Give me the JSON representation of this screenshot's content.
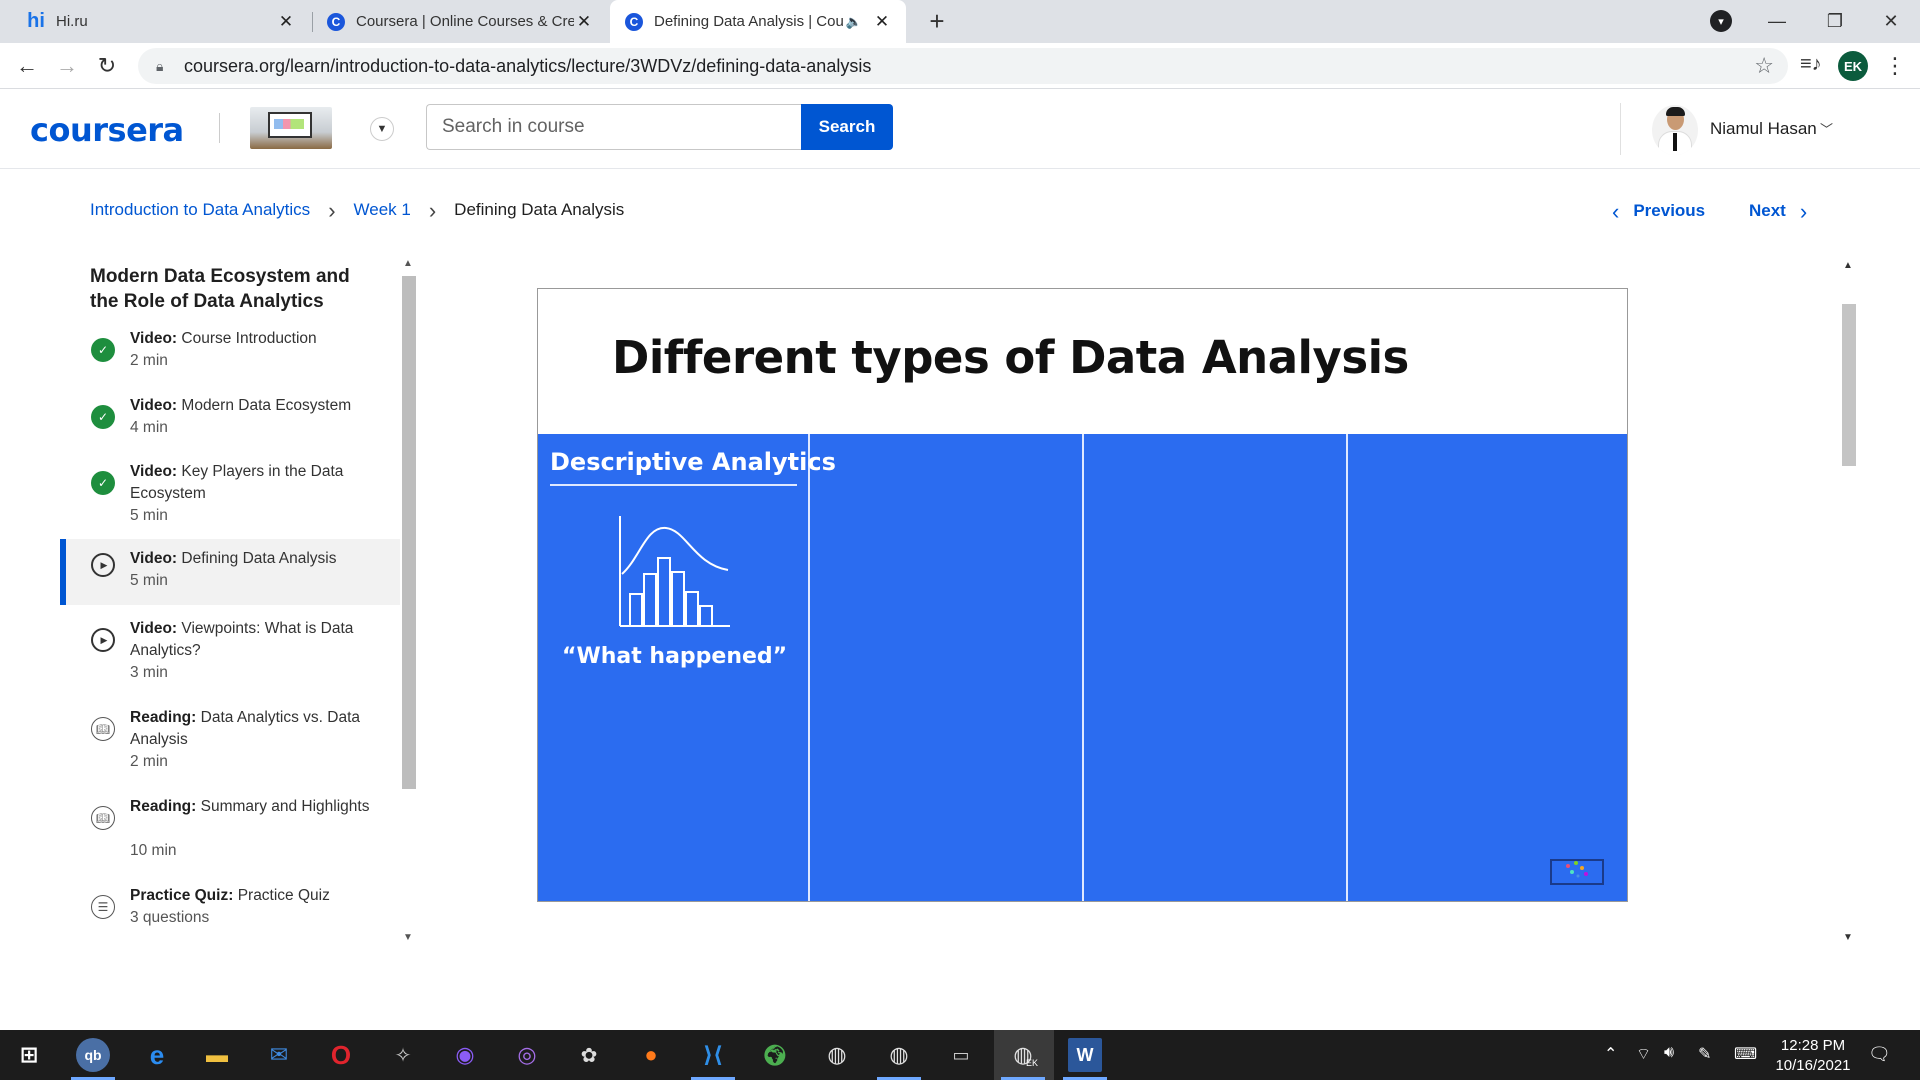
{
  "browser": {
    "tabs": [
      {
        "title": "Hi.ru",
        "favicon": "hi-favicon"
      },
      {
        "title": "Coursera | Online Courses & Crec",
        "favicon": "coursera-favicon"
      },
      {
        "title": "Defining Data Analysis | Cou",
        "favicon": "coursera-favicon",
        "active": true,
        "audio": true
      }
    ],
    "url": "coursera.org/learn/introduction-to-data-analytics/lecture/3WDVz/defining-data-analysis",
    "profile_initials": "EK"
  },
  "header": {
    "logo": "coursera",
    "search_placeholder": "Search in course",
    "search_button": "Search",
    "username": "Niamul Hasan"
  },
  "breadcrumb": {
    "course": "Introduction to Data Analytics",
    "week": "Week 1",
    "current": "Defining Data Analysis"
  },
  "nav": {
    "previous": "Previous",
    "next": "Next"
  },
  "sidebar": {
    "module_title": "Modern Data Ecosystem and the Role of Data Analytics",
    "items": [
      {
        "type": "Video:",
        "title": "Course Introduction",
        "duration": "2 min",
        "status": "done"
      },
      {
        "type": "Video:",
        "title": "Modern Data Ecosystem",
        "duration": "4 min",
        "status": "done"
      },
      {
        "type": "Video:",
        "title": "Key Players in the Data Ecosystem",
        "duration": "5 min",
        "status": "done"
      },
      {
        "type": "Video:",
        "title": "Defining Data Analysis",
        "duration": "5 min",
        "status": "current"
      },
      {
        "type": "Video:",
        "title": "Viewpoints: What is Data Analytics?",
        "duration": "3 min",
        "status": "todo"
      },
      {
        "type": "Reading:",
        "title": "Data Analytics vs. Data Analysis",
        "duration": "2 min",
        "status": "todo"
      },
      {
        "type": "Reading:",
        "title": "Summary and Highlights",
        "duration": "10 min",
        "status": "todo"
      },
      {
        "type": "Practice Quiz:",
        "title": "Practice Quiz",
        "duration": "3 questions",
        "status": "todo"
      }
    ]
  },
  "slide": {
    "title": "Different types of Data Analysis",
    "panel_title": "Descriptive Analytics",
    "panel_quote": "“What happened”",
    "background_color": "#2b6cf0"
  },
  "taskbar": {
    "time": "12:28 PM",
    "date": "10/16/2021",
    "active_badge": "EK"
  }
}
